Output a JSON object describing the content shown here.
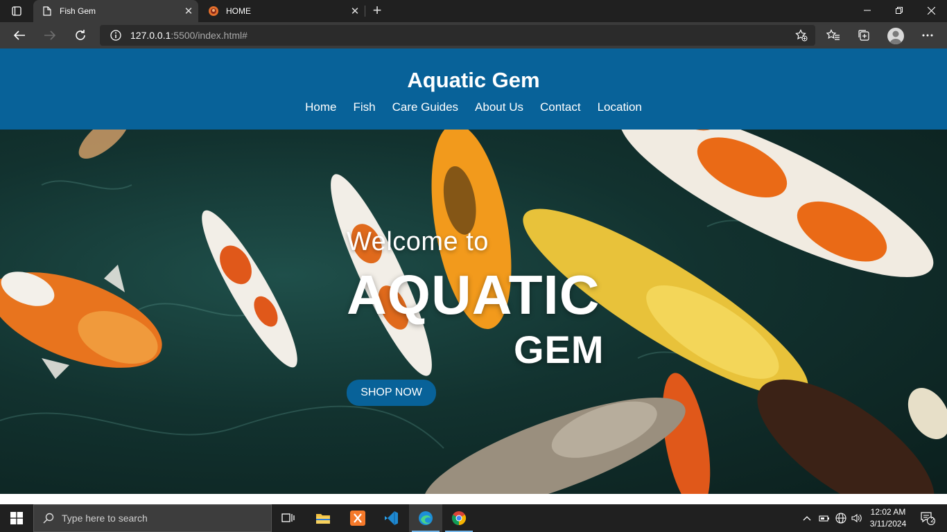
{
  "browser": {
    "tabs": [
      {
        "title": "Fish Gem",
        "active": true,
        "icon": "page-icon"
      },
      {
        "title": "HOME",
        "active": false,
        "icon": "site-favicon"
      }
    ],
    "address": {
      "host": "127.0.0.1",
      "rest": ":5500/index.html#"
    }
  },
  "site": {
    "title": "Aquatic Gem",
    "nav": [
      "Home",
      "Fish",
      "Care Guides",
      "About Us",
      "Contact",
      "Location"
    ],
    "hero": {
      "welcome": "Welcome to",
      "line1": "AQUATIC",
      "line2": "GEM",
      "cta": "SHOP NOW"
    },
    "colors": {
      "brand": "#086299",
      "text": "#ffffff"
    }
  },
  "taskbar": {
    "search_placeholder": "Type here to search",
    "apps": [
      "task-view",
      "file-explorer",
      "xampp",
      "vscode",
      "edge",
      "chrome"
    ],
    "time": "12:02 AM",
    "date": "3/11/2024",
    "notifications": "2"
  }
}
